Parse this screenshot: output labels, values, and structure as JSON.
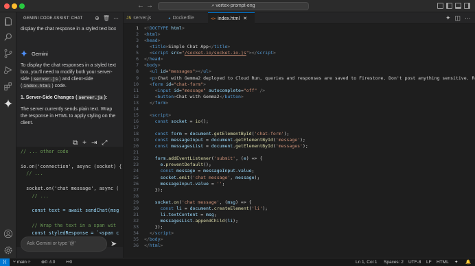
{
  "titlebar": {
    "search_text": "vertex-prompt-eng",
    "back_icon": "arrow-left-icon",
    "forward_icon": "arrow-right-icon"
  },
  "activity_bar": {
    "items": [
      "explorer-icon",
      "search-icon",
      "source-control-icon",
      "run-debug-icon",
      "extensions-icon",
      "gemini-icon",
      "account-icon",
      "settings-icon"
    ]
  },
  "side_panel": {
    "title": "GEMINI CODE ASSIST: CHAT",
    "prev_message": "display the chat response in a styled text box",
    "assistant_name": "Gemini",
    "intro_1": "To display the chat responses in a styled text box, you'll need to modify both your server-side (",
    "intro_chip_1": "server.js",
    "intro_2": ") and client-side (",
    "intro_chip_2": "index.html",
    "intro_3": ") code.",
    "section_title": "1. Server-Side Changes (",
    "section_chip": "server.js",
    "section_close": "):",
    "section_body": "The server currently sends plain text. Wrap the response in HTML to apply styling on the client.",
    "code_lines": [
      "// ... other code",
      "",
      "io.on('connection', async (socket) {",
      "  // ...",
      "",
      "  socket.on('chat message', async (",
      "    // ...",
      "",
      "    const text = await sendChat(msg",
      "",
      "    // Wrap the text in a span wit",
      "    const styledResponse = `<span c"
    ],
    "input_placeholder": "Ask Gemini or type '@'"
  },
  "tabs": [
    {
      "icon": "JS",
      "label": "server.js",
      "active": false
    },
    {
      "icon": "★",
      "label": "Dockerfile",
      "active": false
    },
    {
      "icon": "<>",
      "label": "index.html",
      "active": true
    }
  ],
  "editor": {
    "line_count": 36
  },
  "status_bar": {
    "branch": "main",
    "errors": "0",
    "warnings": "0",
    "ports": "0",
    "position": "Ln 1, Col 1",
    "spaces": "Spaces: 2",
    "encoding": "UTF-8",
    "eol": "LF",
    "language": "HTML"
  },
  "colors": {
    "accent": "#0078d4",
    "gemini": "#4e8ef7"
  }
}
